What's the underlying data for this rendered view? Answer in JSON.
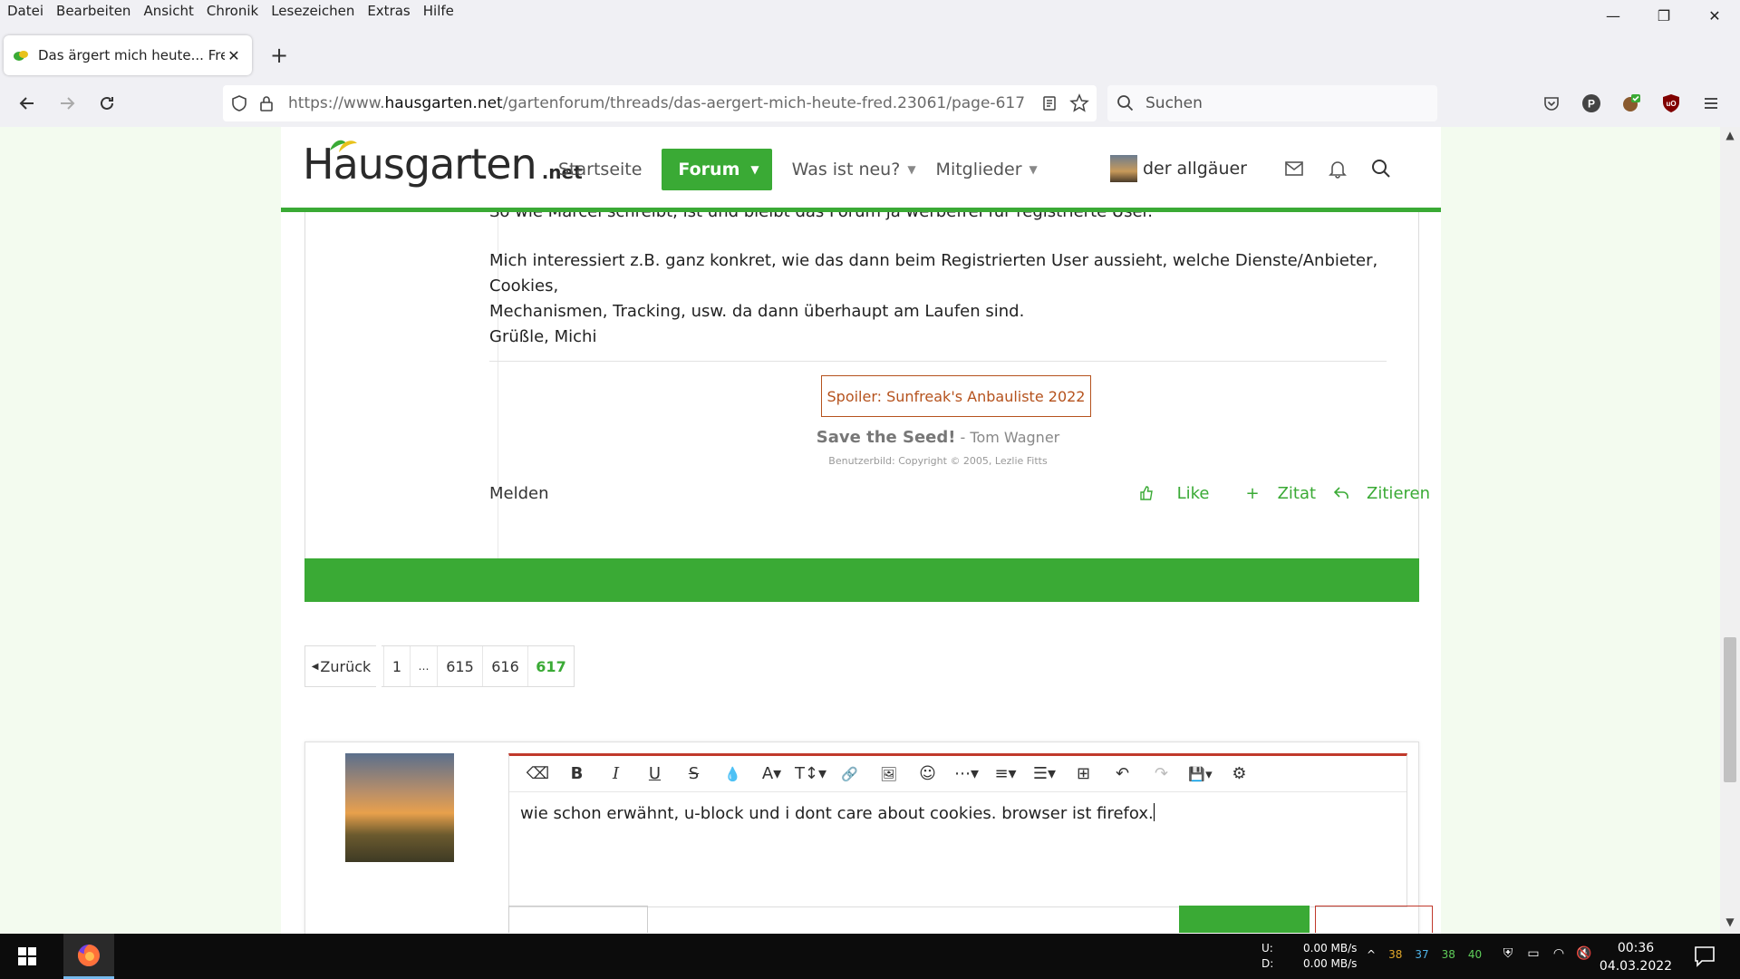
{
  "menubar": {
    "items": [
      "Datei",
      "Bearbeiten",
      "Ansicht",
      "Chronik",
      "Lesezeichen",
      "Extras",
      "Hilfe"
    ]
  },
  "window_controls": {
    "minimize": "—",
    "restore": "❐",
    "close": "✕"
  },
  "tab": {
    "title": "Das ärgert mich heute... Fred - H",
    "close": "✕",
    "new": "+"
  },
  "nav": {
    "url_prefix": "https://www.",
    "url_domain": "hausgarten.net",
    "url_path": "/gartenforum/threads/das-aergert-mich-heute-fred.23061/page-617",
    "search_placeholder": "Suchen"
  },
  "site": {
    "logo_main": "Hausgarten",
    "logo_suffix": ".net",
    "nav": [
      {
        "label": "Startseite",
        "caret": ""
      },
      {
        "label": "Forum",
        "caret": "▼"
      },
      {
        "label": "Was ist neu?",
        "caret": "▼"
      },
      {
        "label": "Mitglieder",
        "caret": "▼"
      }
    ],
    "user_name": "der allgäuer"
  },
  "post": {
    "cut_line": "So wie Marcel schreibt, ist und bleibt das Forum ja werbefrei für registrierte User.",
    "para1_line1": "Mich interessiert z.B. ganz konkret, wie das dann beim Registrierten User aussieht, welche Dienste/Anbieter, Cookies,",
    "para1_line2": "Mechanismen, Tracking, usw. da dann überhaupt am Laufen sind.",
    "greeting": "Grüßle, Michi",
    "spoiler": "Spoiler: Sunfreak's Anbauliste 2022",
    "sig_main": "Save the Seed!",
    "sig_by": " - Tom Wagner",
    "sig_copyright": "Benutzerbild: Copyright © 2005, Lezlie Fitts",
    "report": "Melden",
    "actions": {
      "like": "Like",
      "zitat": "Zitat",
      "zitieren": "Zitieren"
    }
  },
  "pager": {
    "prev": "Zurück",
    "first": "1",
    "dots": "…",
    "p615": "615",
    "p616": "616",
    "current": "617"
  },
  "editor": {
    "toolbar": [
      "⌫",
      "B",
      "I",
      "U",
      "S",
      "💧",
      "A▾",
      "T↕▾",
      "🔗",
      "🖼",
      "☺",
      "⋯▾",
      "≡▾",
      "☰▾",
      "⊞",
      "↶",
      "↷",
      "💾▾",
      "⚙"
    ],
    "text": "wie schon erwähnt, u-block und i dont care about cookies. browser ist firefox."
  },
  "taskbar": {
    "net_labels": [
      "U:",
      "D:"
    ],
    "net_rates": [
      "0.00 MB/s",
      "0.00 MB/s"
    ],
    "temps": [
      "38",
      "37",
      "38",
      "40"
    ],
    "time": "00:36",
    "date": "04.03.2022"
  },
  "colors": {
    "brand_green": "#3aaa35",
    "spoiler_red": "#b5521d",
    "editor_accent": "#c0392b"
  }
}
